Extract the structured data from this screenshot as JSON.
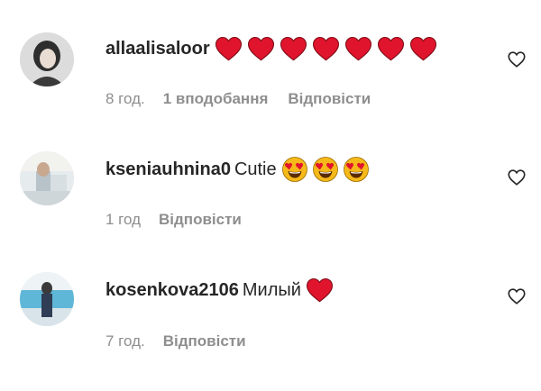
{
  "comments": [
    {
      "username": "allaalisaloor",
      "text": "",
      "emoji": "heart-icon",
      "emoji_count": 7,
      "time": "8 год.",
      "likes": "1 вподобання",
      "reply": "Відповісти"
    },
    {
      "username": "kseniauhnina0",
      "text": "Cutie",
      "emoji": "heart-eyes-emoji-icon",
      "emoji_count": 3,
      "time": "1 год",
      "likes": "",
      "reply": "Відповісти"
    },
    {
      "username": "kosenkova2106",
      "text": "Милый",
      "emoji": "heart-icon",
      "emoji_count": 1,
      "time": "7 год.",
      "likes": "",
      "reply": "Відповісти"
    }
  ],
  "colors": {
    "heart": "#e0142d",
    "emoji_face": "#f5b91a",
    "meta_text": "#8e8e8e",
    "username": "#262626"
  }
}
